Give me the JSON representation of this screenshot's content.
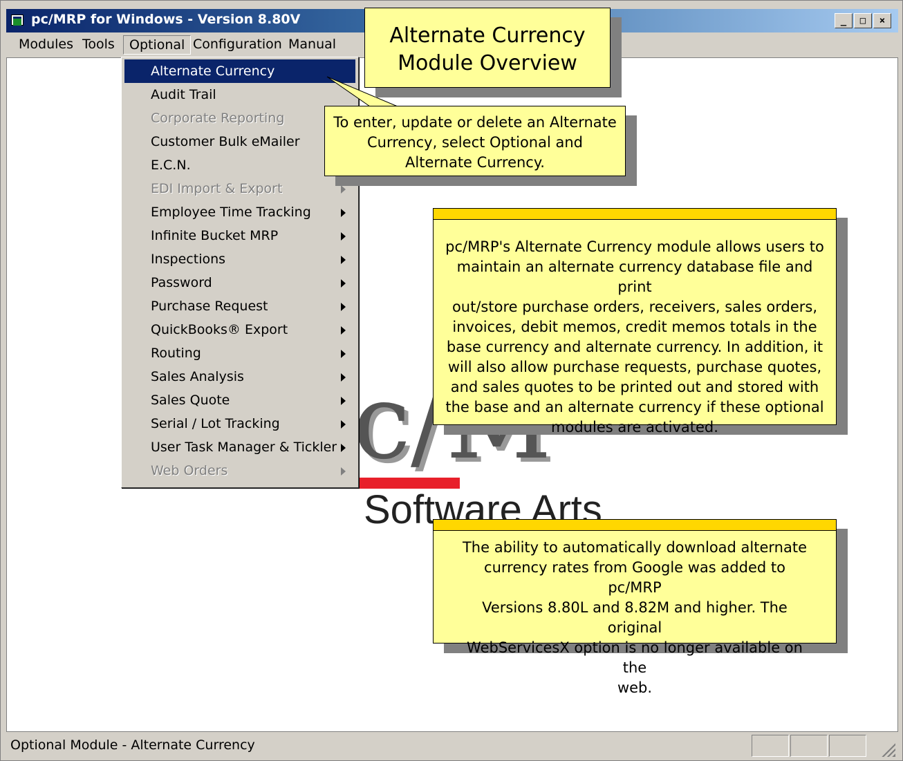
{
  "window": {
    "title": "pc/MRP for Windows - Version 8.80V",
    "buttons": {
      "minimize": "_",
      "maximize": "□",
      "close": "×"
    }
  },
  "menubar": {
    "items": [
      {
        "label": "Modules"
      },
      {
        "label": "Tools"
      },
      {
        "label": "Optional"
      },
      {
        "label": "Configuration"
      },
      {
        "label": "Manual"
      }
    ]
  },
  "dropdown": {
    "items": [
      {
        "label": "Alternate Currency",
        "selected": true,
        "disabled": false,
        "submenu": false
      },
      {
        "label": "Audit Trail",
        "selected": false,
        "disabled": false,
        "submenu": false
      },
      {
        "label": "Corporate Reporting",
        "selected": false,
        "disabled": true,
        "submenu": false
      },
      {
        "label": "Customer Bulk eMailer",
        "selected": false,
        "disabled": false,
        "submenu": false
      },
      {
        "label": "E.C.N.",
        "selected": false,
        "disabled": false,
        "submenu": false
      },
      {
        "label": "EDI Import & Export",
        "selected": false,
        "disabled": true,
        "submenu": true
      },
      {
        "label": "Employee Time Tracking",
        "selected": false,
        "disabled": false,
        "submenu": true
      },
      {
        "label": "Infinite Bucket MRP",
        "selected": false,
        "disabled": false,
        "submenu": true
      },
      {
        "label": "Inspections",
        "selected": false,
        "disabled": false,
        "submenu": true
      },
      {
        "label": "Password",
        "selected": false,
        "disabled": false,
        "submenu": true
      },
      {
        "label": "Purchase Request",
        "selected": false,
        "disabled": false,
        "submenu": true
      },
      {
        "label": "QuickBooks® Export",
        "selected": false,
        "disabled": false,
        "submenu": true
      },
      {
        "label": "Routing",
        "selected": false,
        "disabled": false,
        "submenu": true
      },
      {
        "label": "Sales Analysis",
        "selected": false,
        "disabled": false,
        "submenu": true
      },
      {
        "label": "Sales Quote",
        "selected": false,
        "disabled": false,
        "submenu": true
      },
      {
        "label": "Serial / Lot Tracking",
        "selected": false,
        "disabled": false,
        "submenu": true
      },
      {
        "label": "User Task Manager & Tickler",
        "selected": false,
        "disabled": false,
        "submenu": true
      },
      {
        "label": "Web Orders",
        "selected": false,
        "disabled": true,
        "submenu": true
      }
    ]
  },
  "background_logo": {
    "slash_text": "c/M",
    "company": "Software Arts",
    "bar_color": "#e8202a"
  },
  "callouts": {
    "title_lines": [
      "Alternate Currency",
      "Module Overview"
    ],
    "instruction_lines": [
      "To enter, update or delete an Alternate",
      "Currency, select Optional and",
      "Alternate Currency."
    ],
    "overview_lines": [
      "pc/MRP's Alternate Currency module allows users to",
      "maintain an alternate currency database file and print",
      "out/store purchase orders, receivers, sales orders,",
      "invoices, debit memos, credit memos totals in the",
      "base currency and alternate currency. In addition, it",
      "will also allow purchase requests, purchase quotes,",
      "and sales quotes to be printed out and stored with",
      "the base and an alternate currency if these optional",
      "modules are activated."
    ],
    "note_lines": [
      "The ability to automatically download alternate",
      "currency rates from Google was added to pc/MRP",
      "Versions 8.80L and 8.82M and higher.  The original",
      "WebServicesX option is no longer available on the",
      "web."
    ],
    "fill_color": "#ffff99",
    "accent_color": "#ffd700"
  },
  "statusbar": {
    "text": "Optional Module - Alternate Currency"
  },
  "colors": {
    "selection": "#0a246a",
    "chrome": "#d4d0c8"
  }
}
